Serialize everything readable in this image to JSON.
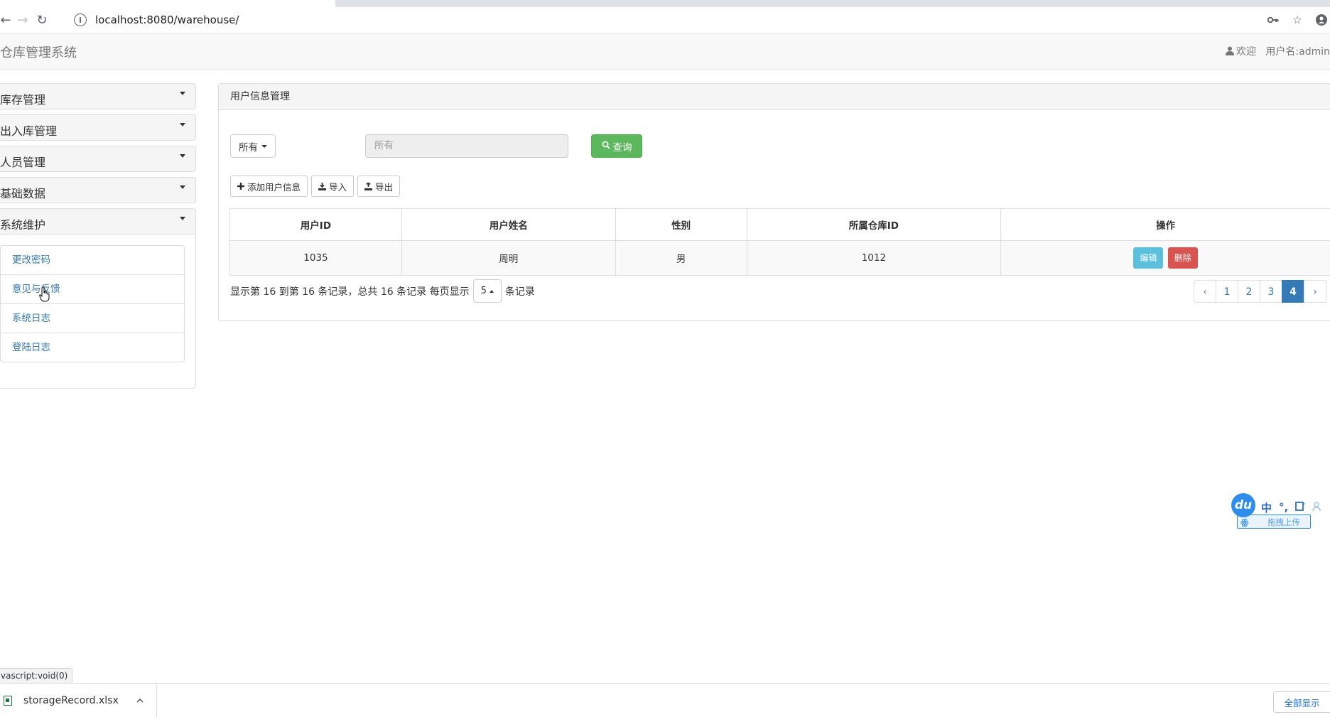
{
  "browser": {
    "url": "localhost:8080/warehouse/"
  },
  "header": {
    "brand": "仓库管理系统",
    "welcome": "欢迎",
    "username": "用户名:admin"
  },
  "sidebar": {
    "groups": [
      {
        "label": "库存管理"
      },
      {
        "label": "出入库管理"
      },
      {
        "label": "人员管理"
      },
      {
        "label": "基础数据"
      },
      {
        "label": "系统维护"
      }
    ],
    "submenu": [
      {
        "label": "更改密码"
      },
      {
        "label": "意见与反馈"
      },
      {
        "label": "系统日志"
      },
      {
        "label": "登陆日志"
      }
    ]
  },
  "panel": {
    "title": "用户信息管理",
    "filter_label": "所有",
    "search_placeholder": "所有",
    "query_label": "查询",
    "actions": {
      "add": "添加用户信息",
      "import": "导入",
      "export": "导出"
    },
    "table": {
      "columns": [
        "用户ID",
        "用户姓名",
        "性别",
        "所属仓库ID",
        "操作"
      ],
      "rows": [
        {
          "id": "1035",
          "name": "周明",
          "gender": "男",
          "warehouse": "1012",
          "edit": "编辑",
          "delete": "删除"
        }
      ]
    },
    "paging": {
      "summary": "显示第 16 到第 16 条记录，总共 16 条记录 每页显示",
      "page_size": "5",
      "suffix": "条记录",
      "prev": "‹",
      "pages": [
        "1",
        "2",
        "3",
        "4"
      ],
      "active_page": "4",
      "next": "›"
    }
  },
  "ime": {
    "logo": "du",
    "mode": "中",
    "punct": "°,",
    "upload": "拖拽上传"
  },
  "status_bar": {
    "link": "vascript:void(0)"
  },
  "downloads": {
    "file": "storageRecord.xlsx",
    "show_all": "全部显示"
  },
  "colors": {
    "success": "#5cb85c",
    "info": "#5bc0de",
    "danger": "#d9534f",
    "primary": "#337ab7"
  }
}
